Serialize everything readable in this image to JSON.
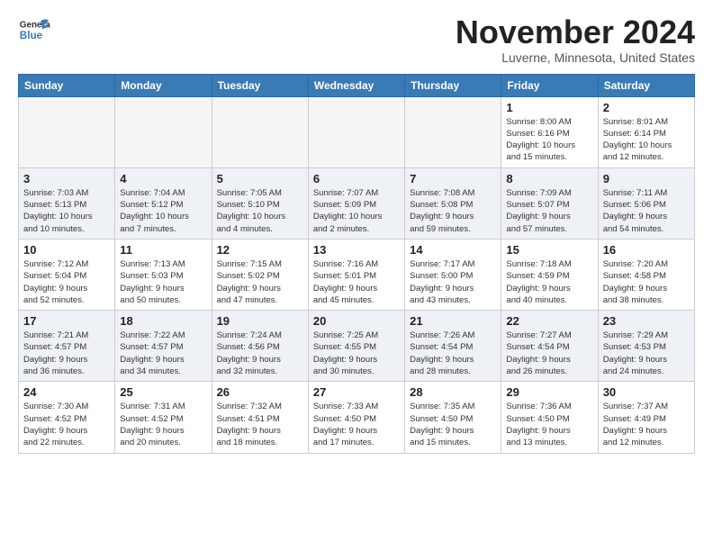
{
  "header": {
    "logo": {
      "general": "General",
      "blue": "Blue"
    },
    "title": "November 2024",
    "location": "Luverne, Minnesota, United States"
  },
  "weekdays": [
    "Sunday",
    "Monday",
    "Tuesday",
    "Wednesday",
    "Thursday",
    "Friday",
    "Saturday"
  ],
  "weeks": [
    [
      {
        "day": "",
        "info": ""
      },
      {
        "day": "",
        "info": ""
      },
      {
        "day": "",
        "info": ""
      },
      {
        "day": "",
        "info": ""
      },
      {
        "day": "",
        "info": ""
      },
      {
        "day": "1",
        "info": "Sunrise: 8:00 AM\nSunset: 6:16 PM\nDaylight: 10 hours\nand 15 minutes."
      },
      {
        "day": "2",
        "info": "Sunrise: 8:01 AM\nSunset: 6:14 PM\nDaylight: 10 hours\nand 12 minutes."
      }
    ],
    [
      {
        "day": "3",
        "info": "Sunrise: 7:03 AM\nSunset: 5:13 PM\nDaylight: 10 hours\nand 10 minutes."
      },
      {
        "day": "4",
        "info": "Sunrise: 7:04 AM\nSunset: 5:12 PM\nDaylight: 10 hours\nand 7 minutes."
      },
      {
        "day": "5",
        "info": "Sunrise: 7:05 AM\nSunset: 5:10 PM\nDaylight: 10 hours\nand 4 minutes."
      },
      {
        "day": "6",
        "info": "Sunrise: 7:07 AM\nSunset: 5:09 PM\nDaylight: 10 hours\nand 2 minutes."
      },
      {
        "day": "7",
        "info": "Sunrise: 7:08 AM\nSunset: 5:08 PM\nDaylight: 9 hours\nand 59 minutes."
      },
      {
        "day": "8",
        "info": "Sunrise: 7:09 AM\nSunset: 5:07 PM\nDaylight: 9 hours\nand 57 minutes."
      },
      {
        "day": "9",
        "info": "Sunrise: 7:11 AM\nSunset: 5:06 PM\nDaylight: 9 hours\nand 54 minutes."
      }
    ],
    [
      {
        "day": "10",
        "info": "Sunrise: 7:12 AM\nSunset: 5:04 PM\nDaylight: 9 hours\nand 52 minutes."
      },
      {
        "day": "11",
        "info": "Sunrise: 7:13 AM\nSunset: 5:03 PM\nDaylight: 9 hours\nand 50 minutes."
      },
      {
        "day": "12",
        "info": "Sunrise: 7:15 AM\nSunset: 5:02 PM\nDaylight: 9 hours\nand 47 minutes."
      },
      {
        "day": "13",
        "info": "Sunrise: 7:16 AM\nSunset: 5:01 PM\nDaylight: 9 hours\nand 45 minutes."
      },
      {
        "day": "14",
        "info": "Sunrise: 7:17 AM\nSunset: 5:00 PM\nDaylight: 9 hours\nand 43 minutes."
      },
      {
        "day": "15",
        "info": "Sunrise: 7:18 AM\nSunset: 4:59 PM\nDaylight: 9 hours\nand 40 minutes."
      },
      {
        "day": "16",
        "info": "Sunrise: 7:20 AM\nSunset: 4:58 PM\nDaylight: 9 hours\nand 38 minutes."
      }
    ],
    [
      {
        "day": "17",
        "info": "Sunrise: 7:21 AM\nSunset: 4:57 PM\nDaylight: 9 hours\nand 36 minutes."
      },
      {
        "day": "18",
        "info": "Sunrise: 7:22 AM\nSunset: 4:57 PM\nDaylight: 9 hours\nand 34 minutes."
      },
      {
        "day": "19",
        "info": "Sunrise: 7:24 AM\nSunset: 4:56 PM\nDaylight: 9 hours\nand 32 minutes."
      },
      {
        "day": "20",
        "info": "Sunrise: 7:25 AM\nSunset: 4:55 PM\nDaylight: 9 hours\nand 30 minutes."
      },
      {
        "day": "21",
        "info": "Sunrise: 7:26 AM\nSunset: 4:54 PM\nDaylight: 9 hours\nand 28 minutes."
      },
      {
        "day": "22",
        "info": "Sunrise: 7:27 AM\nSunset: 4:54 PM\nDaylight: 9 hours\nand 26 minutes."
      },
      {
        "day": "23",
        "info": "Sunrise: 7:29 AM\nSunset: 4:53 PM\nDaylight: 9 hours\nand 24 minutes."
      }
    ],
    [
      {
        "day": "24",
        "info": "Sunrise: 7:30 AM\nSunset: 4:52 PM\nDaylight: 9 hours\nand 22 minutes."
      },
      {
        "day": "25",
        "info": "Sunrise: 7:31 AM\nSunset: 4:52 PM\nDaylight: 9 hours\nand 20 minutes."
      },
      {
        "day": "26",
        "info": "Sunrise: 7:32 AM\nSunset: 4:51 PM\nDaylight: 9 hours\nand 18 minutes."
      },
      {
        "day": "27",
        "info": "Sunrise: 7:33 AM\nSunset: 4:50 PM\nDaylight: 9 hours\nand 17 minutes."
      },
      {
        "day": "28",
        "info": "Sunrise: 7:35 AM\nSunset: 4:50 PM\nDaylight: 9 hours\nand 15 minutes."
      },
      {
        "day": "29",
        "info": "Sunrise: 7:36 AM\nSunset: 4:50 PM\nDaylight: 9 hours\nand 13 minutes."
      },
      {
        "day": "30",
        "info": "Sunrise: 7:37 AM\nSunset: 4:49 PM\nDaylight: 9 hours\nand 12 minutes."
      }
    ]
  ]
}
